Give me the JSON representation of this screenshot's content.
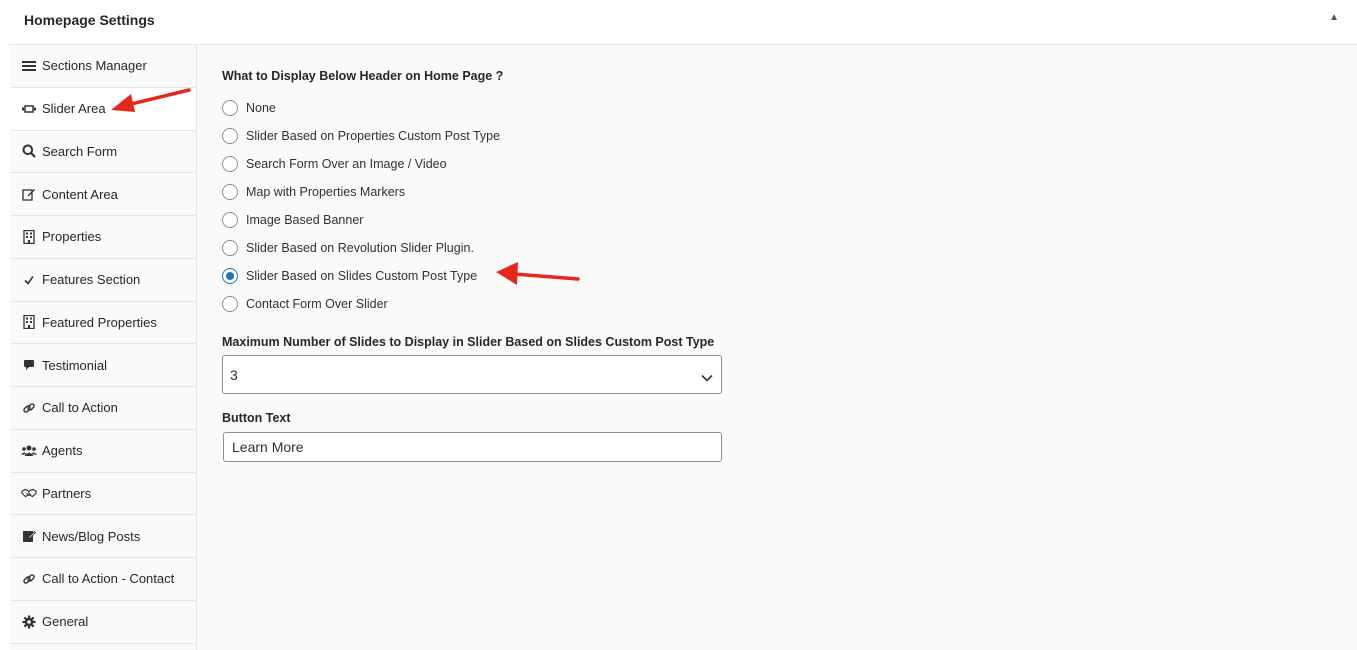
{
  "header": {
    "title": "Homepage Settings",
    "collapse_icon": "▲"
  },
  "sidebar": {
    "items": [
      {
        "label": "Sections Manager",
        "icon": "menu-icon"
      },
      {
        "label": "Slider Area",
        "icon": "slider-icon",
        "active": true
      },
      {
        "label": "Search Form",
        "icon": "search-icon"
      },
      {
        "label": "Content Area",
        "icon": "edit-icon"
      },
      {
        "label": "Properties",
        "icon": "building-icon"
      },
      {
        "label": "Features Section",
        "icon": "check-icon"
      },
      {
        "label": "Featured Properties",
        "icon": "building-icon"
      },
      {
        "label": "Testimonial",
        "icon": "comment-icon"
      },
      {
        "label": "Call to Action",
        "icon": "link-icon"
      },
      {
        "label": "Agents",
        "icon": "users-icon"
      },
      {
        "label": "Partners",
        "icon": "handshake-icon"
      },
      {
        "label": "News/Blog Posts",
        "icon": "pencil-square-icon"
      },
      {
        "label": "Call to Action - Contact",
        "icon": "link-icon"
      },
      {
        "label": "General",
        "icon": "gear-icon"
      }
    ]
  },
  "main": {
    "question": "What to Display Below Header on Home Page ?",
    "options": [
      {
        "label": "None",
        "checked": false
      },
      {
        "label": "Slider Based on Properties Custom Post Type",
        "checked": false
      },
      {
        "label": "Search Form Over an Image / Video",
        "checked": false
      },
      {
        "label": "Map with Properties Markers",
        "checked": false
      },
      {
        "label": "Image Based Banner",
        "checked": false
      },
      {
        "label": "Slider Based on Revolution Slider Plugin.",
        "checked": false
      },
      {
        "label": "Slider Based on Slides Custom Post Type",
        "checked": true
      },
      {
        "label": "Contact Form Over Slider",
        "checked": false
      }
    ],
    "max_slides_label": "Maximum Number of Slides to Display in Slider Based on Slides Custom Post Type",
    "max_slides_value": "3",
    "button_text_label": "Button Text",
    "button_text_value": "Learn More"
  },
  "colors": {
    "accent": "#2271b1",
    "annotation_arrow": "#e8271b"
  }
}
